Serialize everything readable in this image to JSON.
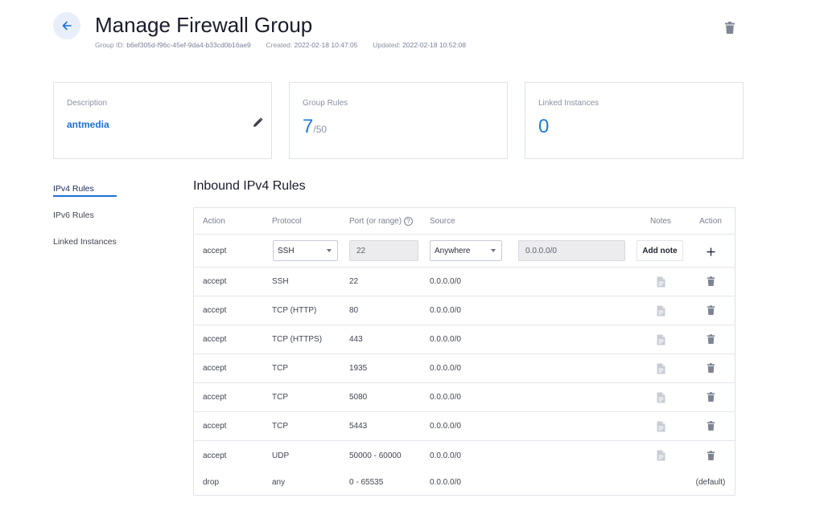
{
  "header": {
    "title": "Manage Firewall Group",
    "group_id_label": "Group ID:",
    "group_id": "b6ef305d-f96c-45ef-9da4-b33cd0b16ae9",
    "created_label": "Created:",
    "created": "2022-02-18 10:47:05",
    "updated_label": "Updated:",
    "updated": "2022-02-18 10:52:08"
  },
  "cards": {
    "description": {
      "label": "Description",
      "value": "antmedia"
    },
    "group_rules": {
      "label": "Group Rules",
      "value": "7",
      "max": "/50"
    },
    "linked_instances": {
      "label": "Linked Instances",
      "value": "0"
    }
  },
  "sidenav": {
    "ipv4": "IPv4 Rules",
    "ipv6": "IPv6 Rules",
    "linked": "Linked Instances"
  },
  "section_title": "Inbound IPv4 Rules",
  "table": {
    "headers": {
      "action": "Action",
      "protocol": "Protocol",
      "port": "Port (or range)",
      "source": "Source",
      "notes": "Notes",
      "action2": "Action"
    },
    "new_rule": {
      "action": "accept",
      "protocol": "SSH",
      "port": "22",
      "source": "Anywhere",
      "source_ip": "0.0.0.0/0",
      "add_note": "Add note"
    },
    "rows": [
      {
        "action": "accept",
        "protocol": "SSH",
        "port": "22",
        "source": "0.0.0.0/0"
      },
      {
        "action": "accept",
        "protocol": "TCP (HTTP)",
        "port": "80",
        "source": "0.0.0.0/0"
      },
      {
        "action": "accept",
        "protocol": "TCP (HTTPS)",
        "port": "443",
        "source": "0.0.0.0/0"
      },
      {
        "action": "accept",
        "protocol": "TCP",
        "port": "1935",
        "source": "0.0.0.0/0"
      },
      {
        "action": "accept",
        "protocol": "TCP",
        "port": "5080",
        "source": "0.0.0.0/0"
      },
      {
        "action": "accept",
        "protocol": "TCP",
        "port": "5443",
        "source": "0.0.0.0/0"
      },
      {
        "action": "accept",
        "protocol": "UDP",
        "port": "50000 - 60000",
        "source": "0.0.0.0/0"
      }
    ],
    "default_row": {
      "action": "drop",
      "protocol": "any",
      "port": "0 - 65535",
      "source": "0.0.0.0/0",
      "label": "(default)"
    }
  },
  "icons": {
    "back": "arrow-left-icon",
    "delete": "trash-icon",
    "edit": "pencil-icon",
    "help": "help-circle-icon",
    "add": "plus-icon",
    "note": "document-icon"
  },
  "colors": {
    "accent": "#1e6fd9",
    "big_number": "#1e7be6",
    "icon_gray": "#7e8494",
    "note_icon": "#c9ccd4"
  }
}
